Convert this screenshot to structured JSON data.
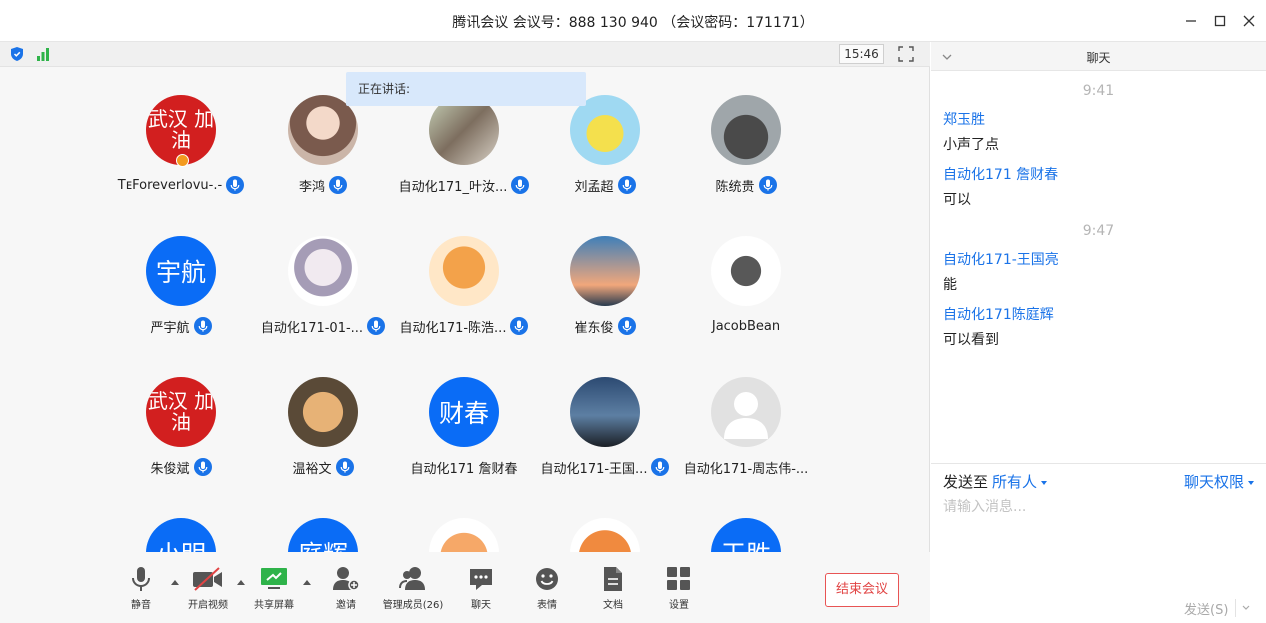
{
  "window": {
    "title": "腾讯会议 会议号：888 130 940 （会议密码：171171）"
  },
  "status": {
    "time": "15:46",
    "speaking_label": "正在讲话:"
  },
  "participants": [
    {
      "name": "TᴇForeverlovu-.-",
      "avatar": "photo-red",
      "avatar_text": "武汉 加油"
    },
    {
      "name": "李鸿",
      "avatar": "photo1",
      "avatar_text": ""
    },
    {
      "name": "自动化171_叶汝...",
      "avatar": "photo2",
      "avatar_text": ""
    },
    {
      "name": "刘孟超",
      "avatar": "photo3",
      "avatar_text": ""
    },
    {
      "name": "陈统贵",
      "avatar": "photo4",
      "avatar_text": ""
    },
    {
      "name": "严宇航",
      "avatar": "blue",
      "avatar_text": "宇航"
    },
    {
      "name": "自动化171-01-...",
      "avatar": "photo5",
      "avatar_text": ""
    },
    {
      "name": "自动化171-陈浩...",
      "avatar": "photo6",
      "avatar_text": ""
    },
    {
      "name": "崔东俊",
      "avatar": "photo7",
      "avatar_text": ""
    },
    {
      "name": "JacobBean",
      "avatar": "photo8",
      "avatar_text": ""
    },
    {
      "name": "朱俊斌",
      "avatar": "photo-red",
      "avatar_text": "武汉 加油"
    },
    {
      "name": "温裕文",
      "avatar": "photo9",
      "avatar_text": ""
    },
    {
      "name": "自动化171 詹财春",
      "avatar": "blue",
      "avatar_text": "财春"
    },
    {
      "name": "自动化171-王国...",
      "avatar": "photo10",
      "avatar_text": ""
    },
    {
      "name": "自动化171-周志伟-...",
      "avatar": "gray",
      "avatar_text": ""
    },
    {
      "name": "",
      "avatar": "blue",
      "avatar_text": "小明"
    },
    {
      "name": "",
      "avatar": "blue",
      "avatar_text": "庭辉"
    },
    {
      "name": "",
      "avatar": "photo11",
      "avatar_text": ""
    },
    {
      "name": "",
      "avatar": "photo12",
      "avatar_text": ""
    },
    {
      "name": "",
      "avatar": "blue",
      "avatar_text": "王胜"
    }
  ],
  "toolbar": {
    "mute": "静音",
    "video": "开启视频",
    "share": "共享屏幕",
    "invite": "邀请",
    "members": "管理成员(26)",
    "chat": "聊天",
    "reaction": "表情",
    "docs": "文档",
    "settings": "设置",
    "end": "结束会议"
  },
  "chat": {
    "title": "聊天",
    "messages": [
      {
        "time": "9:41"
      },
      {
        "sender": "郑玉胜",
        "text": "小声了点"
      },
      {
        "sender": "自动化171 詹财春",
        "text": "可以"
      },
      {
        "time": "9:47"
      },
      {
        "sender": "自动化171-王国亮",
        "text": "能"
      },
      {
        "sender": "自动化171陈庭辉",
        "text": "可以看到"
      }
    ],
    "send_to_label": "发送至",
    "send_to_target": "所有人",
    "permissions": "聊天权限",
    "input_placeholder": "请输入消息...",
    "send_button": "发送(S)"
  },
  "colors": {
    "accent": "#1a73e8",
    "avatar_blue": "#0a6cf6",
    "end_red": "#e14444"
  }
}
